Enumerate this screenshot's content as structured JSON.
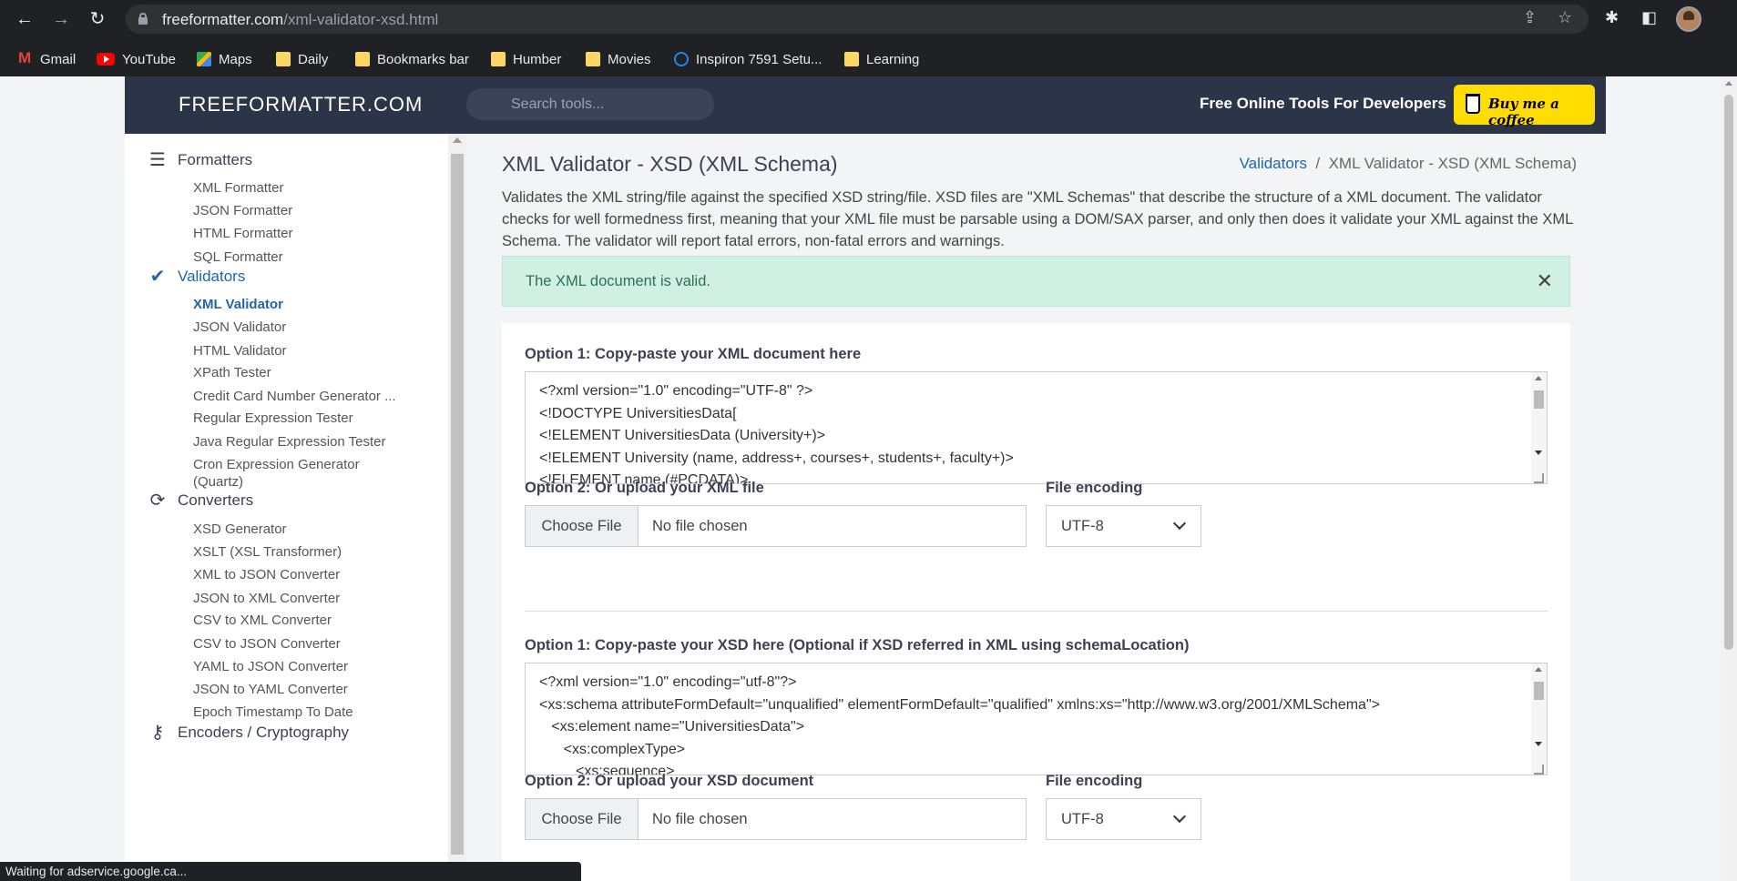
{
  "browser": {
    "url_domain": "freeformatter.com",
    "url_path": "/xml-validator-xsd.html",
    "bookmarks": [
      {
        "label": "Gmail",
        "icon": "gmail-icon"
      },
      {
        "label": "YouTube",
        "icon": "youtube-icon"
      },
      {
        "label": "Maps",
        "icon": "maps-icon"
      },
      {
        "label": "Daily",
        "icon": "folder-icon"
      },
      {
        "label": "Bookmarks bar",
        "icon": "folder-icon"
      },
      {
        "label": "Humber",
        "icon": "folder-icon"
      },
      {
        "label": "Movies",
        "icon": "folder-icon"
      },
      {
        "label": "Inspiron 7591 Setu...",
        "icon": "dell-icon"
      },
      {
        "label": "Learning",
        "icon": "folder-icon"
      }
    ],
    "status_text": "Waiting for adservice.google.ca..."
  },
  "header": {
    "logo": "FREEFORMATTER.COM",
    "search_placeholder": "Search tools...",
    "tagline": "Free Online Tools For Developers",
    "coffee_label": "Buy me a coffee",
    "accent": "#ffdd00",
    "bg": "#2c3447"
  },
  "sidebar": {
    "sections": {
      "formatters": "Formatters",
      "validators": "Validators",
      "converters": "Converters",
      "encoders": "Encoders / Cryptography"
    },
    "formatters": [
      "XML Formatter",
      "JSON Formatter",
      "HTML Formatter",
      "SQL Formatter"
    ],
    "validators": [
      "XML Validator",
      "JSON Validator",
      "HTML Validator",
      "XPath Tester",
      "Credit Card Number Generator ...",
      "Regular Expression Tester",
      "Java Regular Expression Tester",
      "Cron Expression Generator",
      "(Quartz)"
    ],
    "converters": [
      "XSD Generator",
      "XSLT (XSL Transformer)",
      "XML to JSON Converter",
      "JSON to XML Converter",
      "CSV to XML Converter",
      "CSV to JSON Converter",
      "YAML to JSON Converter",
      "JSON to YAML Converter",
      "Epoch Timestamp To Date"
    ],
    "active_color": "#2364aa"
  },
  "main": {
    "title": "XML Validator - XSD (XML Schema)",
    "breadcrumb_link": "Validators",
    "breadcrumb_sep": "/",
    "breadcrumb_current": "XML Validator - XSD (XML Schema)",
    "intro": "Validates the XML string/file against the specified XSD string/file. XSD files are \"XML Schemas\" that describe the structure of a XML document. The validator checks for well formedness first, meaning that your XML file must be parsable using a DOM/SAX parser, and only then does it validate your XML against the XML Schema. The validator will report fatal errors, non-fatal errors and warnings.",
    "alert": "The XML document is valid.",
    "alert_color": "#d1f0e4",
    "xml_label": "Option 1: Copy-paste your XML document here",
    "xml_text": "<?xml version=\"1.0\" encoding=\"UTF-8\" ?>\n<!DOCTYPE UniversitiesData[\n<!ELEMENT UniversitiesData (University+)>\n<!ELEMENT University (name, address+, courses+, students+, faculty+)>\n<!ELEMENT name (#PCDATA)>",
    "xml_upload_label": "Option 2: Or upload your XML file",
    "xsd_label": "Option 1: Copy-paste your XSD here (Optional if XSD referred in XML using schemaLocation)",
    "xsd_text": "<?xml version=\"1.0\" encoding=\"utf-8\"?>\n<xs:schema attributeFormDefault=\"unqualified\" elementFormDefault=\"qualified\" xmlns:xs=\"http://www.w3.org/2001/XMLSchema\">\n   <xs:element name=\"UniversitiesData\">\n      <xs:complexType>\n         <xs:sequence>",
    "xsd_upload_label": "Option 2: Or upload your XSD document",
    "encoding_label": "File encoding",
    "encoding_value": "UTF-8",
    "choose_file": "Choose File",
    "choose_file_partial": "se File",
    "no_file": "No file chosen"
  }
}
